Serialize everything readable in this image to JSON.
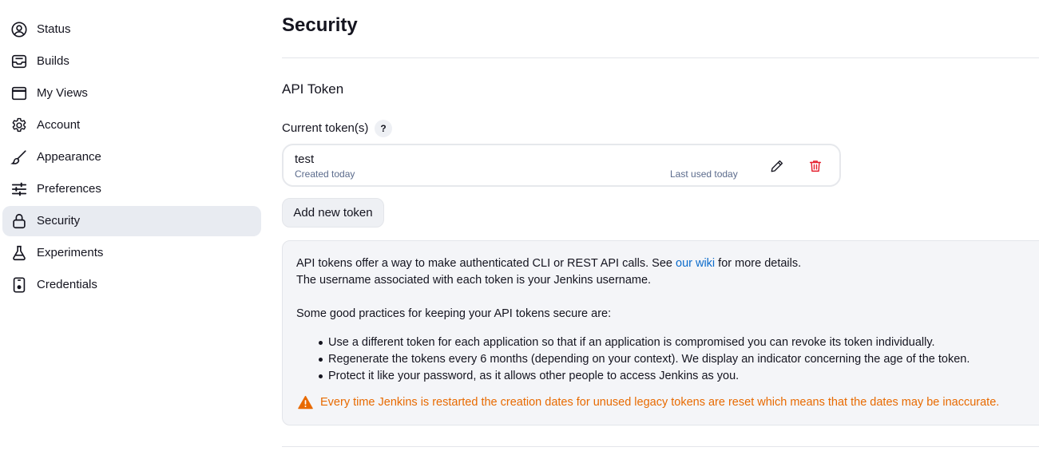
{
  "sidebar": {
    "items": [
      {
        "label": "Status",
        "icon": "user-circle-icon",
        "active": false
      },
      {
        "label": "Builds",
        "icon": "inbox-tray-icon",
        "active": false
      },
      {
        "label": "My Views",
        "icon": "window-icon",
        "active": false
      },
      {
        "label": "Account",
        "icon": "gear-icon",
        "active": false
      },
      {
        "label": "Appearance",
        "icon": "paintbrush-icon",
        "active": false
      },
      {
        "label": "Preferences",
        "icon": "sliders-icon",
        "active": false
      },
      {
        "label": "Security",
        "icon": "lock-icon",
        "active": true
      },
      {
        "label": "Experiments",
        "icon": "flask-icon",
        "active": false
      },
      {
        "label": "Credentials",
        "icon": "id-card-icon",
        "active": false
      }
    ]
  },
  "main": {
    "title": "Security",
    "section_title": "API Token",
    "current_tokens_label": "Current token(s)",
    "help_label": "?",
    "token": {
      "name": "test",
      "created": "Created today",
      "last_used": "Last used today"
    },
    "add_button_label": "Add new token",
    "info": {
      "line1_prefix": "API tokens offer a way to make authenticated CLI or REST API calls. See ",
      "line1_link": "our wiki",
      "line1_suffix": " for more details.",
      "line2": "The username associated with each token is your Jenkins username.",
      "practices_intro": "Some good practices for keeping your API tokens secure are:",
      "bullets": [
        "Use a different token for each application so that if an application is compromised you can revoke its token individually.",
        "Regenerate the tokens every 6 months (depending on your context). We display an indicator concerning the age of the token.",
        "Protect it like your password, as it allows other people to access Jenkins as you."
      ],
      "warning": "Every time Jenkins is restarted the creation dates for unused legacy tokens are reset which means that the dates may be inaccurate."
    }
  },
  "colors": {
    "active_bg": "#e8ebf1",
    "link": "#0b6bcb",
    "warning": "#e86a00",
    "delete": "#e5202e",
    "muted_text": "#5b6b8c"
  }
}
